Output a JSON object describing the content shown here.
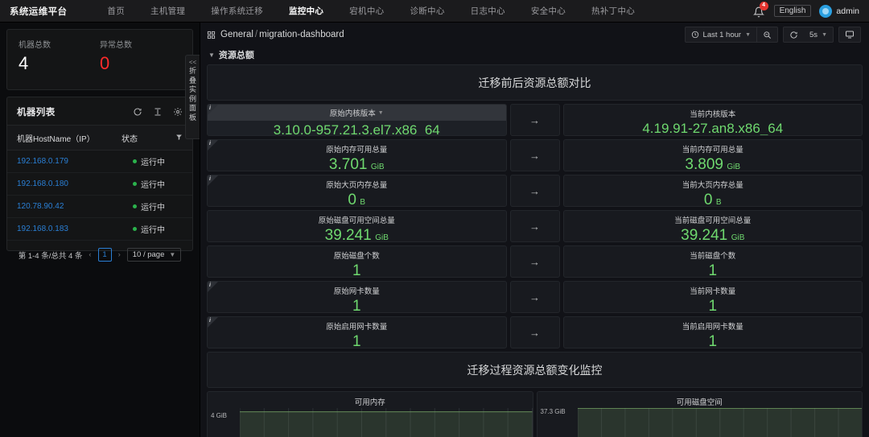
{
  "topnav": {
    "brand": "系统运维平台",
    "links": [
      {
        "label": "首页",
        "active": false
      },
      {
        "label": "主机管理",
        "active": false
      },
      {
        "label": "操作系统迁移",
        "active": false
      },
      {
        "label": "监控中心",
        "active": true
      },
      {
        "label": "宕机中心",
        "active": false
      },
      {
        "label": "诊断中心",
        "active": false
      },
      {
        "label": "日志中心",
        "active": false
      },
      {
        "label": "安全中心",
        "active": false
      },
      {
        "label": "热补丁中心",
        "active": false
      }
    ],
    "notification_count": "4",
    "language": "English",
    "username": "admin"
  },
  "sidebar": {
    "stats": [
      {
        "label": "机器总数",
        "value": "4",
        "danger": false
      },
      {
        "label": "异常总数",
        "value": "0",
        "danger": true
      }
    ],
    "list_title": "机器列表",
    "columns": [
      "机器HostName（IP）",
      "状态"
    ],
    "rows": [
      {
        "ip": "192.168.0.179",
        "status": "运行中"
      },
      {
        "ip": "192.168.0.180",
        "status": "运行中"
      },
      {
        "ip": "120.78.90.42",
        "status": "运行中"
      },
      {
        "ip": "192.168.0.183",
        "status": "运行中"
      }
    ],
    "pagination": {
      "summary": "第 1-4 条/总共 4 条",
      "prev": "‹",
      "page": "1",
      "next": "›",
      "page_size": "10 / page"
    },
    "collapse_tab": {
      "chevrons": "<<",
      "text": "折叠实例面板"
    }
  },
  "dashboard": {
    "breadcrumb_folder": "General",
    "breadcrumb_sep": "/",
    "breadcrumb_name": "migration-dashboard",
    "toolbar": {
      "time_range": "Last 1 hour",
      "refresh_interval": "5s"
    },
    "section_title": "资源总额",
    "banner_top": "迁移前后资源总额对比",
    "banner_bottom": "迁移过程资源总额变化监控",
    "arrow": "→",
    "comparisons": [
      {
        "left_title": "原始内核版本",
        "left_value": "3.10.0-957.21.3.el7.x86_64",
        "left_unit": "",
        "right_title": "当前内核版本",
        "right_value": "4.19.91-27.an8.x86_64",
        "right_unit": "",
        "left_info": true,
        "left_hovered": true,
        "small": true
      },
      {
        "left_title": "原始内存可用总量",
        "left_value": "3.701",
        "left_unit": "GiB",
        "right_title": "当前内存可用总量",
        "right_value": "3.809",
        "right_unit": "GiB",
        "left_info": true,
        "left_hovered": false,
        "small": false
      },
      {
        "left_title": "原始大页内存总量",
        "left_value": "0",
        "left_unit": "B",
        "right_title": "当前大页内存总量",
        "right_value": "0",
        "right_unit": "B",
        "left_info": true,
        "left_hovered": false,
        "small": false
      },
      {
        "left_title": "原始磁盘可用空间总量",
        "left_value": "39.241",
        "left_unit": "GiB",
        "right_title": "当前磁盘可用空间总量",
        "right_value": "39.241",
        "right_unit": "GiB",
        "left_info": false,
        "left_hovered": false,
        "small": false
      },
      {
        "left_title": "原始磁盘个数",
        "left_value": "1",
        "left_unit": "",
        "right_title": "当前磁盘个数",
        "right_value": "1",
        "right_unit": "",
        "left_info": false,
        "left_hovered": false,
        "small": false
      },
      {
        "left_title": "原始网卡数量",
        "left_value": "1",
        "left_unit": "",
        "right_title": "当前网卡数量",
        "right_value": "1",
        "right_unit": "",
        "left_info": true,
        "left_hovered": false,
        "small": false
      },
      {
        "left_title": "原始启用网卡数量",
        "left_value": "1",
        "left_unit": "",
        "right_title": "当前启用网卡数量",
        "right_value": "1",
        "right_unit": "",
        "left_info": true,
        "left_hovered": false,
        "small": false
      }
    ]
  },
  "chart_data": [
    {
      "type": "area",
      "title": "可用内存",
      "xlabel": "",
      "ylabel": "",
      "yticks": [
        "4 GiB"
      ],
      "ylim": [
        0,
        4.2
      ],
      "grid": true,
      "series": [
        {
          "name": "可用内存",
          "color": "#7eb26d",
          "values": [
            3.7,
            3.7,
            3.7,
            3.7,
            3.7,
            3.7,
            3.7,
            3.7,
            3.7,
            3.7,
            3.7,
            3.7,
            3.7,
            3.7,
            3.7,
            3.7,
            3.7,
            3.7,
            3.7,
            3.7
          ]
        }
      ]
    },
    {
      "type": "area",
      "title": "可用磁盘空间",
      "xlabel": "",
      "ylabel": "",
      "yticks": [
        "37.3 GiB"
      ],
      "ylim": [
        0,
        39.5
      ],
      "grid": true,
      "series": [
        {
          "name": "可用磁盘空间",
          "color": "#7eb26d",
          "values": [
            39.24,
            39.24,
            39.24,
            39.24,
            39.24,
            39.24,
            39.24,
            39.24,
            39.24,
            39.24,
            39.24,
            39.24,
            39.24,
            39.24,
            39.24,
            39.24,
            39.24,
            39.24,
            39.24,
            39.24
          ]
        }
      ]
    }
  ],
  "colors": {
    "accent_green": "#6fd96f",
    "danger_red": "#ff2b2b",
    "link_blue": "#2a7fd4",
    "status_green": "#2bb24c",
    "chart_line": "#7eb26d"
  }
}
